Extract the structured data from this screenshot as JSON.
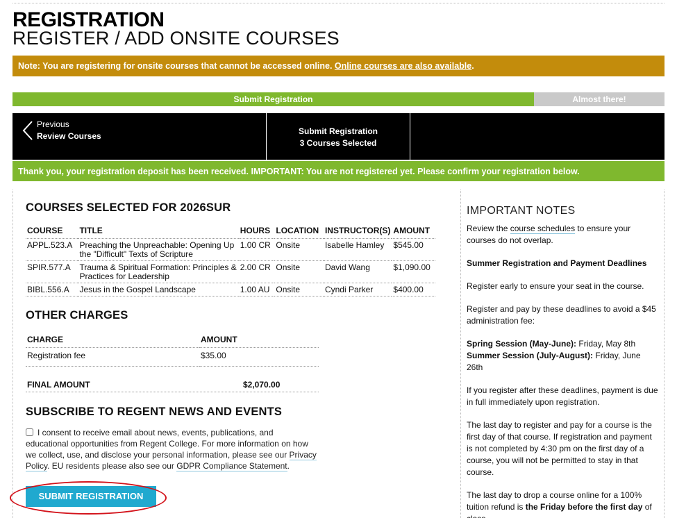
{
  "header": {
    "title": "REGISTRATION",
    "subtitle": "REGISTER / ADD ONSITE COURSES"
  },
  "note": {
    "text": "Note: You are registering for onsite courses that cannot be accessed online. ",
    "link": "Online courses are also available",
    "suffix": ".",
    "color": "#c38c0c"
  },
  "progress": {
    "current_label": "Submit Registration",
    "remaining_label": "Almost there!",
    "fraction": 0.8
  },
  "steps": {
    "previous_label": "Previous",
    "previous_step": "Review Courses",
    "current_line1": "Submit Registration",
    "current_line2": "3 Courses Selected"
  },
  "success": {
    "text": "Thank you, your registration deposit has been received. IMPORTANT: You are not registered yet. Please confirm your registration below.",
    "color": "#7fb82e"
  },
  "courses": {
    "heading": "COURSES SELECTED FOR 2026SUR",
    "columns": [
      "COURSE",
      "TITLE",
      "HOURS",
      "LOCATION",
      "INSTRUCTOR(S)",
      "AMOUNT"
    ],
    "rows": [
      {
        "course": "APPL.523.A",
        "title": "Preaching the Unpreachable: Opening Up the \"Difficult\" Texts of Scripture",
        "hours": "1.00 CR",
        "location": "Onsite",
        "instructor": "Isabelle Hamley",
        "amount": "$545.00"
      },
      {
        "course": "SPIR.577.A",
        "title": "Trauma & Spiritual Formation: Principles & Practices for Leadership",
        "hours": "2.00 CR",
        "location": "Onsite",
        "instructor": "David Wang",
        "amount": "$1,090.00"
      },
      {
        "course": "BIBL.556.A",
        "title": "Jesus in the Gospel Landscape",
        "hours": "1.00 AU",
        "location": "Onsite",
        "instructor": "Cyndi Parker",
        "amount": "$400.00"
      }
    ]
  },
  "charges": {
    "heading": "OTHER CHARGES",
    "columns": [
      "CHARGE",
      "AMOUNT"
    ],
    "rows": [
      {
        "charge": "Registration fee",
        "amount": "$35.00"
      }
    ],
    "final_label": "FINAL AMOUNT",
    "final_amount": "$2,070.00"
  },
  "subscribe": {
    "heading": "SUBSCRIBE TO REGENT NEWS AND EVENTS",
    "consent_text": "I consent to receive email about news, events, publications, and educational opportunities from Regent College. For more information on how we collect, use, and disclose your personal information, please see our ",
    "privacy_link": "Privacy Policy",
    "mid_text": ". EU residents please also see our ",
    "gdpr_link": "GDPR Compliance Statement",
    "end_text": ".",
    "checked": false
  },
  "submit_label": "SUBMIT REGISTRATION",
  "notes": {
    "title": "IMPORTANT NOTES",
    "p1_pre": "Review the ",
    "p1_link": "course schedules",
    "p1_post": " to ensure your courses do not overlap.",
    "deadlines_heading": "Summer Registration and Payment Deadlines",
    "p2": "Register early to ensure your seat in the course.",
    "p3": "Register and pay by these deadlines to avoid a $45 administration fee:",
    "spring_label": "Spring Session (May-June):",
    "spring_date": " Friday, May 8th",
    "summer_label": "Summer Session (July-August):",
    "summer_date": " Friday, June 26th",
    "p4": "If you register after these deadlines, payment is due in full immediately upon registration.",
    "p5": "The last day to register and pay for a course is the first day of that course. If registration and payment is not completed by 4:30 pm on the first day of a course, you will not be permitted to stay in that course.",
    "p6_pre": "The last day to drop a course online for a 100% tuition refund is ",
    "p6_bold": "the Friday before the first day",
    "p6_post": " of class."
  }
}
